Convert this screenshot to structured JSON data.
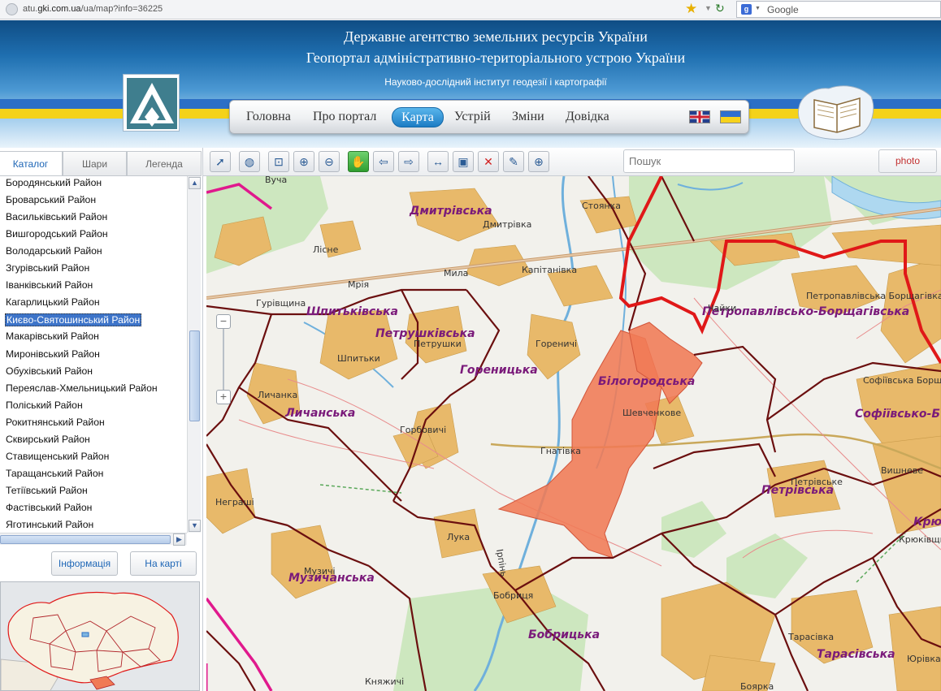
{
  "browser": {
    "url_prefix": "atu.",
    "url_domain": "gki.com.ua",
    "url_rest": "/ua/map?info=36225",
    "search_engine": "Google"
  },
  "header": {
    "line1": "Державне агентство земельних ресурсів України",
    "line2": "Геопортал адміністративно-територіального устрою України",
    "line3": "Науково-дослідний інститут геодезії і картографії"
  },
  "nav": {
    "items": [
      "Головна",
      "Про портал",
      "Карта",
      "Устрій",
      "Зміни",
      "Довідка"
    ],
    "active": "Карта"
  },
  "panel": {
    "tabs": [
      "Каталог",
      "Шари",
      "Легенда"
    ],
    "active_tab": "Каталог",
    "districts": [
      "Бородянський Район",
      "Броварський Район",
      "Васильківський Район",
      "Вишгородський Район",
      "Володарський Район",
      "Згурівський Район",
      "Іванківський Район",
      "Кагарлицький Район",
      "Києво-Святошинський Район",
      "Макарівський Район",
      "Миронівський Район",
      "Обухівський Район",
      "Переяслав-Хмельницький Район",
      "Поліський Район",
      "Рокитнянський Район",
      "Сквирський Район",
      "Ставищенський Район",
      "Таращанський Район",
      "Тетіївський Район",
      "Фастівський Район",
      "Яготинський Район"
    ],
    "selected": "Києво-Святошинський Район",
    "info_button": "Інформація",
    "on_map_button": "На карті"
  },
  "toolbar": {
    "search_placeholder": "Пошук",
    "photo_label": "photo",
    "tools": [
      "select-info-icon",
      "globe-icon",
      "zoom-extent-icon",
      "zoom-in-icon",
      "zoom-out-icon",
      "pan-hand-icon",
      "back-arrow-icon",
      "forward-arrow-icon",
      "measure-distance-icon",
      "measure-area-icon",
      "clear-measure-icon",
      "pencil-icon",
      "target-icon"
    ]
  },
  "map": {
    "council_labels": [
      "Дмитрівська",
      "Шпитьківська",
      "Петрушківська",
      "Гореницька",
      "Білогородська",
      "Петропавлівсько-Борщагівська",
      "Софіївсько-Б",
      "Личанська",
      "Петрівська",
      "Музичанська",
      "Бобрицька",
      "Тарасівська",
      "Крю"
    ],
    "village_labels": [
      "Стоянка",
      "Дмитрівка",
      "Лісне",
      "Мрія",
      "Мила",
      "Капітанівка",
      "Гурівщина",
      "Петрушки",
      "Шпитьки",
      "Гореничі",
      "Личанка",
      "Горбовичі",
      "Шевченкове",
      "Гнатівка",
      "Неграші",
      "Лука",
      "Музичі",
      "Бобриця",
      "Княжичі",
      "Петрівське",
      "Вишневе",
      "Тарасівка",
      "Юрівка",
      "Боярка",
      "Софіївська Борщагівка",
      "Петропавлівська Борщагівка",
      "Чайки",
      "Крюківщина",
      "Вуча",
      "Ірпінь"
    ],
    "colors": {
      "settlement": "#e8b96a",
      "forest": "#cde7bf",
      "water": "#aed8f0",
      "council_border": "#6b0f0f",
      "city_border": "#e01818",
      "oblast_border": "#e0198d",
      "selected_fill": "#f07a55"
    }
  }
}
